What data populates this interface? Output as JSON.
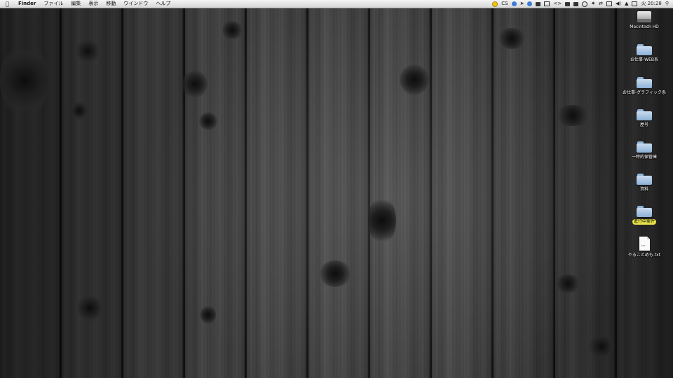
{
  "menubar": {
    "apple_icon": "apple-icon",
    "app_name": "Finder",
    "menus": [
      "ファイル",
      "編集",
      "表示",
      "移動",
      "ウインドウ",
      "ヘルプ"
    ],
    "status": {
      "cs_label": "CS",
      "clock": "火 20:28",
      "search_icon": "search-icon"
    }
  },
  "desktop": {
    "items": [
      {
        "label": "Macintosh HD",
        "icon": "hard-drive-icon"
      },
      {
        "label": "お仕事-WEB系",
        "icon": "folder-icon"
      },
      {
        "label": "お仕事-グラフィック系",
        "icon": "folder-icon"
      },
      {
        "label": "屋号",
        "icon": "folder-icon"
      },
      {
        "label": "一時的保管庫",
        "icon": "folder-icon"
      },
      {
        "label": "資料",
        "icon": "folder-icon"
      },
      {
        "label": "進行中案件",
        "icon": "folder-icon",
        "label_color": "#e9e34a"
      },
      {
        "label": "やることめも.txt",
        "icon": "text-file-icon",
        "file_badge": "TXT"
      }
    ]
  }
}
